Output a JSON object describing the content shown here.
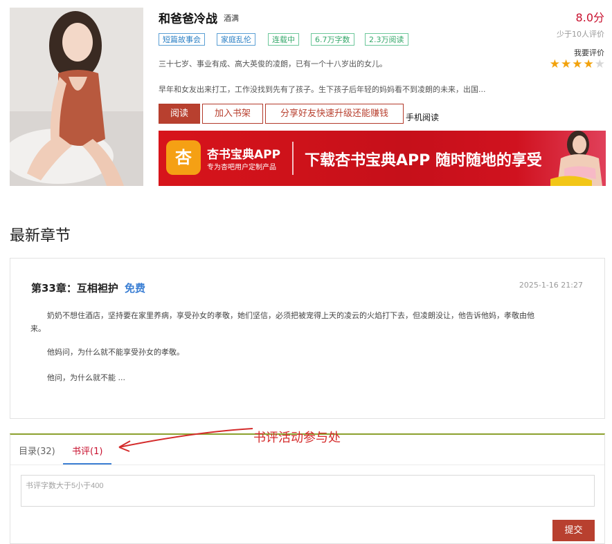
{
  "book": {
    "title": "和爸爸冷战",
    "author": "酒满",
    "score": "8.0分",
    "rating_count": "少于10人评价",
    "rate_link": "我要评价",
    "stars_filled": 4,
    "stars_total": 5,
    "tags": [
      "短篇故事会",
      "家庭乱伦",
      "连载中",
      "6.7万字数",
      "2.3万阅读"
    ],
    "intro_line1": "三十七岁、事业有成、高大英俊的凌朗，已有一个十八岁出的女儿。",
    "intro_line2": "早年和女友出来打工，工作没找到先有了孩子。生下孩子后年轻的妈妈看不到凌朗的未来，出国..."
  },
  "actions": {
    "read": "阅读",
    "add_shelf": "加入书架",
    "share": "分享好友快速升级还能赚钱",
    "mobile": "手机阅读"
  },
  "banner": {
    "logo_glyph": "杏",
    "app_name": "杏书宝典APP",
    "sub": "专为杏吧用户定制产品",
    "slogan": "下载杏书宝典APP 随时随地的享受"
  },
  "latest": {
    "section_title": "最新章节",
    "chapter_title": "第33章：互相袒护",
    "free_label": "免费",
    "time": "2025-1-16 21:27",
    "para1_line1": "奶奶不想住酒店，坚持要在家里养病，享受孙女的孝敬，她们坚信，必须把被宠得上天的凌云的火焰打下去，但凌朗没让，他告诉他妈，孝敬由他",
    "para1_line2": "来。",
    "para2": "他妈问，为什么就不能享受孙女的孝敬。",
    "para3": "他问，为什么就不能 ..."
  },
  "tabs": {
    "catalog": "目录(32)",
    "reviews": "书评(1)"
  },
  "review": {
    "placeholder": "书评字数大于5小于400",
    "submit": "提交"
  },
  "annotation": {
    "text": "书评活动参与处"
  },
  "colors": {
    "accent_red": "#b8402f",
    "price_red": "#c8102e",
    "tag_blue": "#2a7fc4",
    "tag_green": "#35a86a",
    "star": "#f2a20c"
  }
}
